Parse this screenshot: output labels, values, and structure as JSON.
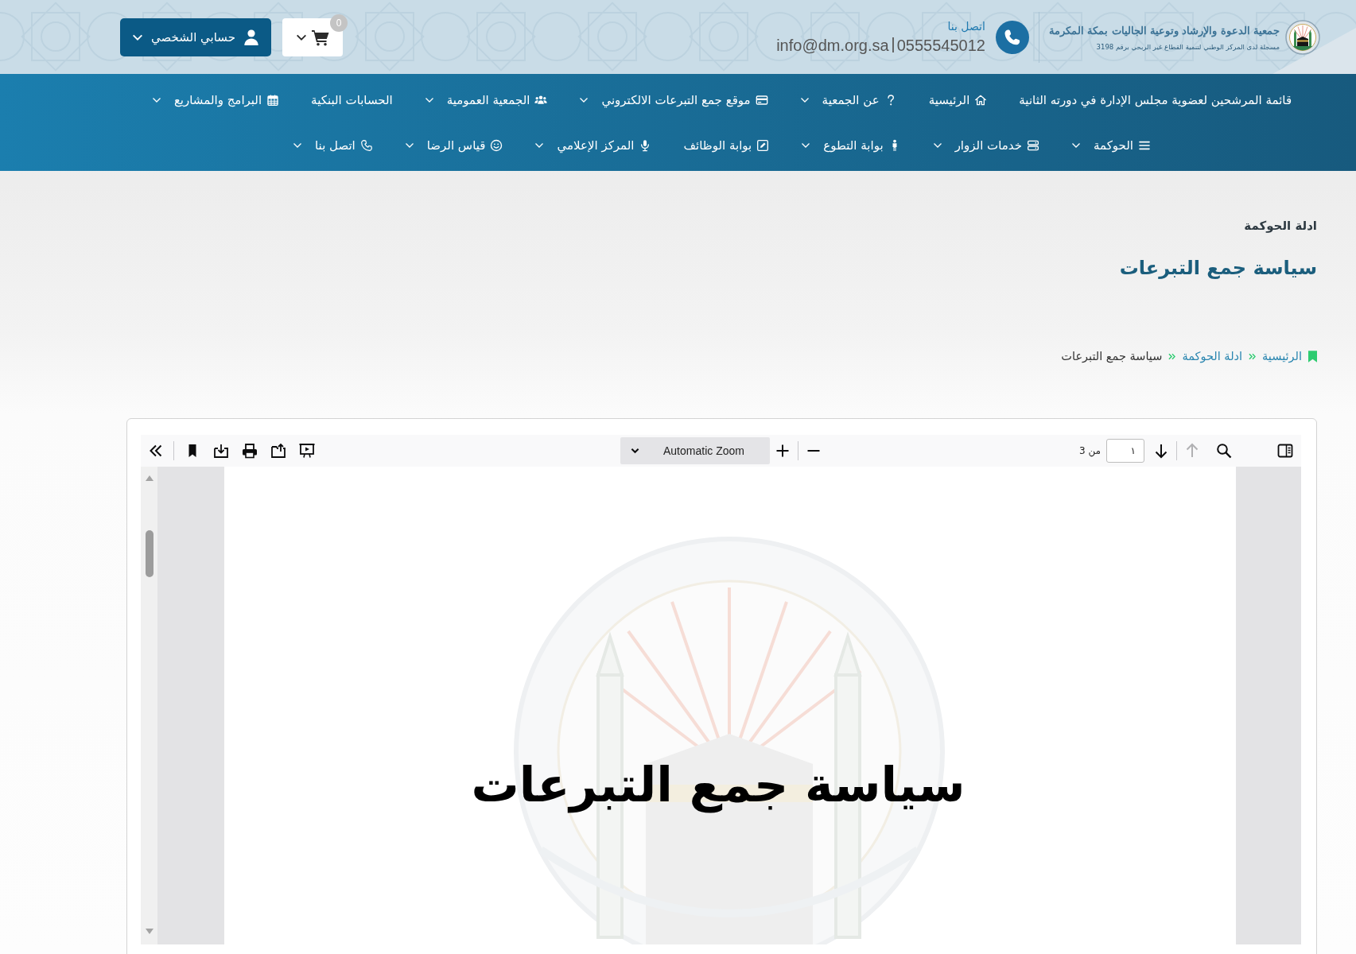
{
  "header": {
    "logo": {
      "title": "جمعية الدعوة والإرشاد وتوعية الجاليات بمكة المكرمة",
      "subtitle": "مسجلة لدى المركز الوطني لتنمية القطاع غير الربحي برقم 3198"
    },
    "contact": {
      "label": "اتصل بنا",
      "phone": "0555545012",
      "email": "info@dm.org.sa"
    },
    "cart": {
      "count": "0"
    },
    "account": {
      "label": "حسابي الشخصي"
    }
  },
  "nav": {
    "items": [
      {
        "label": "قائمة المرشحين لعضوية مجلس الإدارة في دورته الثانية",
        "dropdown": false
      },
      {
        "label": "الرئيسية",
        "dropdown": false
      },
      {
        "label": "عن الجمعية",
        "dropdown": true
      },
      {
        "label": "موقع جمع التبرعات الالكتروني",
        "dropdown": true
      },
      {
        "label": "الجمعية العمومية",
        "dropdown": true
      },
      {
        "label": "الحسابات البنكية",
        "dropdown": false
      },
      {
        "label": "البرامج والمشاريع",
        "dropdown": true
      },
      {
        "label": "الحوكمة",
        "dropdown": true
      },
      {
        "label": "خدمات الزوار",
        "dropdown": true
      },
      {
        "label": "بوابة التطوع",
        "dropdown": true
      },
      {
        "label": "بوابة الوظائف",
        "dropdown": false
      },
      {
        "label": "المركز الإعلامي",
        "dropdown": true
      },
      {
        "label": "قياس الرضا",
        "dropdown": true
      },
      {
        "label": "اتصل بنا",
        "dropdown": true
      }
    ]
  },
  "page_header": {
    "section": "ادلة الحوكمة",
    "title": "سياسة جمع التبرعات"
  },
  "breadcrumb": [
    {
      "label": "الرئيسية",
      "current": false
    },
    {
      "label": "ادلة الحوكمة",
      "current": false
    },
    {
      "label": "سياسة جمع التبرعات",
      "current": true
    }
  ],
  "viewer": {
    "toolbar": {
      "zoom": "Automatic Zoom",
      "page_number": "١",
      "page_count": "من 3",
      "previous_page": {
        "disabled": true
      },
      "next_page": {
        "disabled": false
      }
    },
    "document": {
      "title": "سياسة جمع التبرعات"
    }
  }
}
